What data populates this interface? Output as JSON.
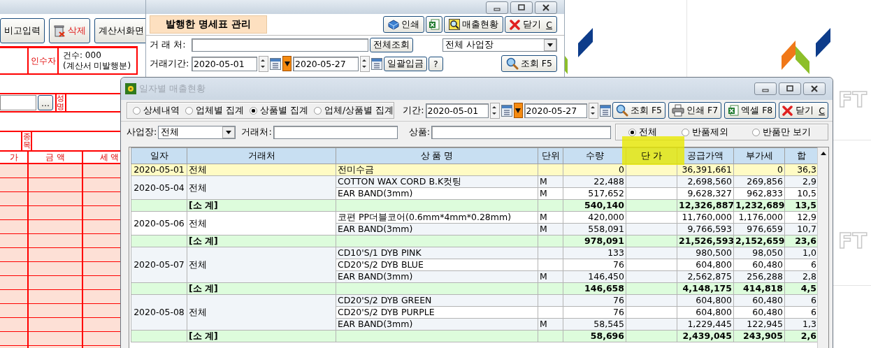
{
  "backdrop": {
    "logo_texts": [
      "FT",
      "FT"
    ]
  },
  "background_window": {
    "buttons": [
      {
        "label": "비고입력",
        "kind": "plain"
      },
      {
        "label": "삭제",
        "kind": "delete"
      },
      {
        "label": "계산서화면",
        "kind": "plain"
      }
    ],
    "recipient_label": "인수자",
    "count_text": "건수: 000",
    "count_note": "(계산서 미발행분)",
    "browse_button": "...",
    "name_label": "성명",
    "item_label": "종목",
    "columns": [
      "가",
      "금 액",
      "세 액"
    ]
  },
  "manager_window": {
    "title": "발행한 명세표 관리",
    "buttons": [
      {
        "label": "인쇄",
        "kind": "box"
      },
      {
        "kind": "excel"
      },
      {
        "label": "매출현황",
        "kind": "magnifier"
      },
      {
        "label": "닫기",
        "accel": "C",
        "kind": "close"
      }
    ],
    "client_label": "거 래 처:",
    "all_button": "전체조회",
    "site_combo": "전체 사업장",
    "period_label": "거래기간:",
    "date_from": "2020-05-01",
    "date_to": "2020-05-27",
    "deposit_button": "일괄입금",
    "help_button": "?",
    "search_button": "조회 F5"
  },
  "dialog": {
    "title": "일자별 매출현황",
    "active": false,
    "view_options": [
      {
        "label": "상세내역",
        "selected": false
      },
      {
        "label": "업체별 집계",
        "selected": false
      },
      {
        "label": "상품별 집계",
        "selected": true
      },
      {
        "label": "업체/상품별 집계",
        "selected": false
      }
    ],
    "period_label": "기간:",
    "date_from": "2020-05-01",
    "date_to": "2020-05-27",
    "actions": [
      {
        "label": "조회 F5",
        "kind": "search"
      },
      {
        "label": "인쇄 F7",
        "kind": "print"
      },
      {
        "label": "엑셀 F8",
        "kind": "excel"
      },
      {
        "label": "닫기",
        "accel": "C",
        "kind": "close"
      }
    ],
    "site_label": "사업장:",
    "site_value": "전체",
    "client_label": "거래처:",
    "product_label": "상품:",
    "return_options": [
      {
        "label": "전체",
        "selected": true
      },
      {
        "label": "반품제외",
        "selected": false
      },
      {
        "label": "반품만 보기",
        "selected": false
      }
    ],
    "table": {
      "columns": [
        {
          "label": "일자",
          "highlighted": false
        },
        {
          "label": "거래처",
          "highlighted": false
        },
        {
          "label": "상 품 명",
          "highlighted": false
        },
        {
          "label": "단위",
          "highlighted": false
        },
        {
          "label": "수량",
          "highlighted": false
        },
        {
          "label": "단 가",
          "highlighted": true
        },
        {
          "label": "공급가액",
          "highlighted": false
        },
        {
          "label": "부가세",
          "highlighted": false
        },
        {
          "label": "합",
          "highlighted": false
        }
      ],
      "groups": [
        {
          "kind": "carryover",
          "date": "2020-05-01",
          "client": "전체",
          "items": [
            {
              "product": "전미수금",
              "qty": "0",
              "supply": "36,391,661",
              "vat": "0",
              "total": "36,3"
            }
          ]
        },
        {
          "kind": "daily",
          "date": "2020-05-04",
          "client": "전체",
          "items": [
            {
              "product": "COTTON WAX CORD B.K컷팅",
              "unit": "M",
              "qty": "22,488",
              "supply": "2,698,560",
              "vat": "269,856",
              "total": "2,9",
              "shaded": true
            },
            {
              "product": "EAR BAND(3mm)",
              "unit": "M",
              "qty": "517,652",
              "supply": "9,628,327",
              "vat": "962,833",
              "total": "10,5",
              "shaded": false
            }
          ],
          "subtotal": {
            "label": "[소 계]",
            "qty": "540,140",
            "supply": "12,326,887",
            "vat": "1,232,689",
            "total": "13,5"
          }
        },
        {
          "kind": "daily",
          "date": "2020-05-06",
          "client": "전체",
          "items": [
            {
              "product": "코편 PP더블코어(0.6mm*4mm*0.28mm)",
              "unit": "M",
              "qty": "420,000",
              "supply": "11,760,000",
              "vat": "1,176,000",
              "total": "12,9",
              "shaded": false
            },
            {
              "product": "EAR BAND(3mm)",
              "unit": "M",
              "qty": "558,091",
              "supply": "9,766,593",
              "vat": "976,659",
              "total": "10,7",
              "shaded": true
            }
          ],
          "subtotal": {
            "label": "[소 계]",
            "qty": "978,091",
            "supply": "21,526,593",
            "vat": "2,152,659",
            "total": "23,6"
          }
        },
        {
          "kind": "daily",
          "date": "2020-05-07",
          "client": "전체",
          "items": [
            {
              "product": "CD10'S/1 DYB PINK",
              "qty": "133",
              "supply": "980,500",
              "vat": "98,050",
              "total": "1,0",
              "shaded": true
            },
            {
              "product": "CD20'S/2 DYB BLUE",
              "qty": "76",
              "supply": "604,800",
              "vat": "60,480",
              "total": "6",
              "shaded": false
            },
            {
              "product": "EAR BAND(3mm)",
              "unit": "M",
              "qty": "146,450",
              "supply": "2,562,875",
              "vat": "256,288",
              "total": "2,8",
              "shaded": true
            }
          ],
          "subtotal": {
            "label": "[소 계]",
            "qty": "146,658",
            "supply": "4,148,175",
            "vat": "414,818",
            "total": "4,5"
          }
        },
        {
          "kind": "daily",
          "date": "2020-05-08",
          "client": "전체",
          "items": [
            {
              "product": "CD20'S/2 DYB GREEN",
              "qty": "76",
              "supply": "604,800",
              "vat": "60,480",
              "total": "6",
              "shaded": true
            },
            {
              "product": "CD20'S/2 DYB PURPLE",
              "qty": "76",
              "supply": "604,800",
              "vat": "60,480",
              "total": "6",
              "shaded": false
            },
            {
              "product": "EAR BAND(3mm)",
              "unit": "M",
              "qty": "58,545",
              "supply": "1,229,445",
              "vat": "122,945",
              "total": "1,3",
              "shaded": true
            }
          ],
          "subtotal": {
            "label": "[소 계]",
            "qty": "58,696",
            "supply": "2,439,045",
            "vat": "243,905",
            "total": "2,6"
          }
        }
      ]
    }
  }
}
